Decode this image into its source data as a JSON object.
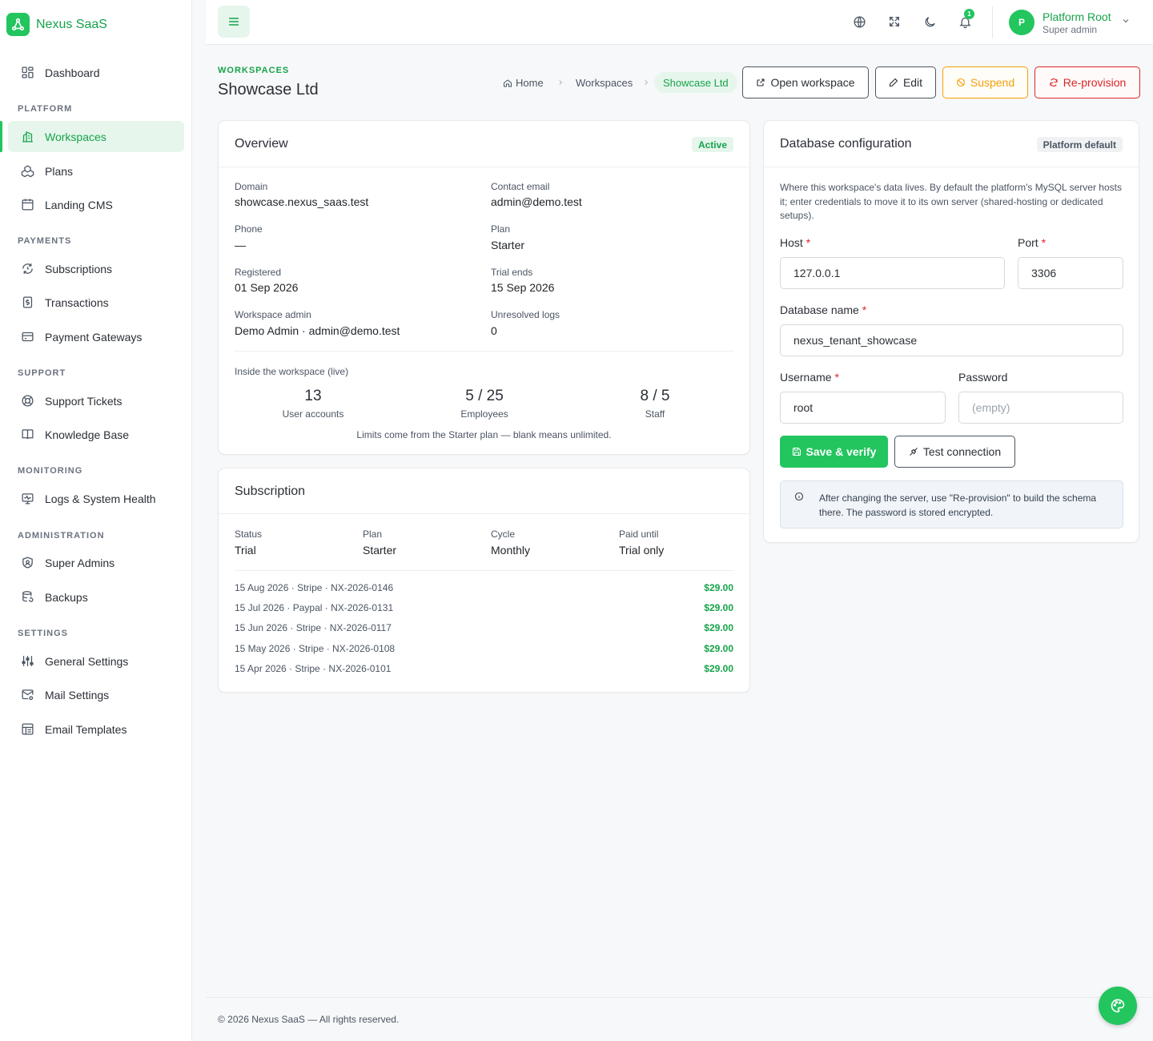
{
  "app": {
    "name": "Nexus SaaS",
    "logo_icon": "nexus-logo-icon"
  },
  "sidebar": {
    "sections": [
      "PLATFORM",
      "PAYMENTS",
      "SUPPORT",
      "MONITORING",
      "ADMINISTRATION",
      "SETTINGS"
    ],
    "items": [
      {
        "label": "Dashboard",
        "icon": "dashboard-icon"
      },
      {
        "label": "Workspaces",
        "icon": "workspaces-icon",
        "active": true
      },
      {
        "label": "Plans",
        "icon": "plans-icon"
      },
      {
        "label": "Landing CMS",
        "icon": "landing-cms-icon"
      },
      {
        "label": "Subscriptions",
        "icon": "subscriptions-icon"
      },
      {
        "label": "Transactions",
        "icon": "transactions-icon"
      },
      {
        "label": "Payment Gateways",
        "icon": "payment-gateways-icon"
      },
      {
        "label": "Support Tickets",
        "icon": "support-tickets-icon"
      },
      {
        "label": "Knowledge Base",
        "icon": "knowledge-base-icon"
      },
      {
        "label": "Logs & System Health",
        "icon": "logs-icon"
      },
      {
        "label": "Super Admins",
        "icon": "super-admins-icon"
      },
      {
        "label": "Backups",
        "icon": "backups-icon"
      },
      {
        "label": "General Settings",
        "icon": "general-settings-icon"
      },
      {
        "label": "Mail Settings",
        "icon": "mail-settings-icon"
      },
      {
        "label": "Email Templates",
        "icon": "email-templates-icon"
      }
    ]
  },
  "topbar": {
    "notification_count": "1",
    "user": {
      "initial": "P",
      "name": "Platform Root",
      "role": "Super admin"
    }
  },
  "page": {
    "eyebrow": "WORKSPACES",
    "title": "Showcase Ltd",
    "breadcrumb": [
      "Home",
      "Workspaces",
      "Showcase Ltd"
    ],
    "actions": {
      "open": "Open workspace",
      "edit": "Edit",
      "suspend": "Suspend",
      "reprovision": "Re-provision"
    }
  },
  "overview": {
    "title": "Overview",
    "status": "Active",
    "fields": [
      {
        "label": "Domain",
        "value": "showcase.nexus_saas.test"
      },
      {
        "label": "Contact email",
        "value": "admin@demo.test"
      },
      {
        "label": "Phone",
        "value": "—"
      },
      {
        "label": "Plan",
        "value": "Starter"
      },
      {
        "label": "Registered",
        "value": "01 Sep 2026"
      },
      {
        "label": "Trial ends",
        "value": "15 Sep 2026"
      },
      {
        "label": "Workspace admin",
        "value": "Demo Admin · admin@demo.test"
      },
      {
        "label": "Unresolved logs",
        "value": "0"
      }
    ],
    "live_title": "Inside the workspace (live)",
    "stats": [
      {
        "value": "13",
        "label": "User accounts"
      },
      {
        "value": "5 / 25",
        "label": "Employees"
      },
      {
        "value": "8 / 5",
        "label": "Staff"
      }
    ],
    "note": "Limits come from the Starter plan — blank means unlimited."
  },
  "subscription": {
    "title": "Subscription",
    "fields": [
      {
        "label": "Status",
        "value": "Trial"
      },
      {
        "label": "Plan",
        "value": "Starter"
      },
      {
        "label": "Cycle",
        "value": "Monthly"
      },
      {
        "label": "Paid until",
        "value": "Trial only"
      }
    ],
    "payments": [
      {
        "desc": "15 Aug 2026 · Stripe · NX-2026-0146",
        "amount": "$29.00"
      },
      {
        "desc": "15 Jul 2026 · Paypal · NX-2026-0131",
        "amount": "$29.00"
      },
      {
        "desc": "15 Jun 2026 · Stripe · NX-2026-0117",
        "amount": "$29.00"
      },
      {
        "desc": "15 May 2026 · Stripe · NX-2026-0108",
        "amount": "$29.00"
      },
      {
        "desc": "15 Apr 2026 · Stripe · NX-2026-0101",
        "amount": "$29.00"
      }
    ]
  },
  "database": {
    "title": "Database configuration",
    "badge": "Platform default",
    "description": "Where this workspace's data lives. By default the platform's MySQL server hosts it; enter credentials to move it to its own server (shared-hosting or dedicated setups).",
    "host_label": "Host",
    "host_value": "127.0.0.1",
    "port_label": "Port",
    "port_value": "3306",
    "dbname_label": "Database name",
    "dbname_value": "nexus_tenant_showcase",
    "username_label": "Username",
    "username_value": "root",
    "password_label": "Password",
    "password_placeholder": "(empty)",
    "save_label": "Save & verify",
    "test_label": "Test connection",
    "info": "After changing the server, use \"Re-provision\" to build the schema there. The password is stored encrypted."
  },
  "footer": {
    "text": "© 2026 Nexus SaaS — All rights reserved."
  },
  "colors": {
    "accent": "#22c55e",
    "accent_dark": "#16a34a",
    "warning": "#f59e0b",
    "danger": "#dc2626"
  }
}
